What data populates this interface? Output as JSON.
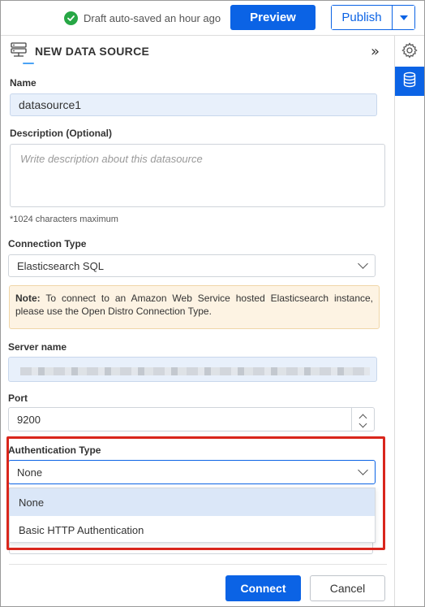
{
  "topbar": {
    "draft_status": "Draft auto-saved an hour ago",
    "preview_label": "Preview",
    "publish_label": "Publish"
  },
  "panel": {
    "title": "NEW DATA SOURCE",
    "collapse_glyph": "»"
  },
  "form": {
    "name_label": "Name",
    "name_value": "datasource1",
    "description_label": "Description (Optional)",
    "description_placeholder": "Write description about this datasource",
    "description_hint": "*1024 characters maximum",
    "connection_type_label": "Connection Type",
    "connection_type_value": "Elasticsearch SQL",
    "note_prefix": "Note:",
    "note_text": " To connect to an Amazon Web Service hosted Elasticsearch instance, please use the Open Distro Connection Type.",
    "server_name_label": "Server name",
    "port_label": "Port",
    "port_value": "9200",
    "auth_type_label": "Authentication Type",
    "auth_type_value": "None",
    "auth_options": [
      "None",
      "Basic HTTP Authentication"
    ]
  },
  "footer": {
    "connect_label": "Connect",
    "cancel_label": "Cancel"
  },
  "icons": {
    "status": "check-circle-icon",
    "panel": "server-icon",
    "rail_settings": "gear-icon",
    "rail_data": "database-icon"
  },
  "colors": {
    "accent": "#0b63e5",
    "success": "#27a745",
    "highlight": "#d9261c",
    "note_bg": "#fdf3e3"
  }
}
